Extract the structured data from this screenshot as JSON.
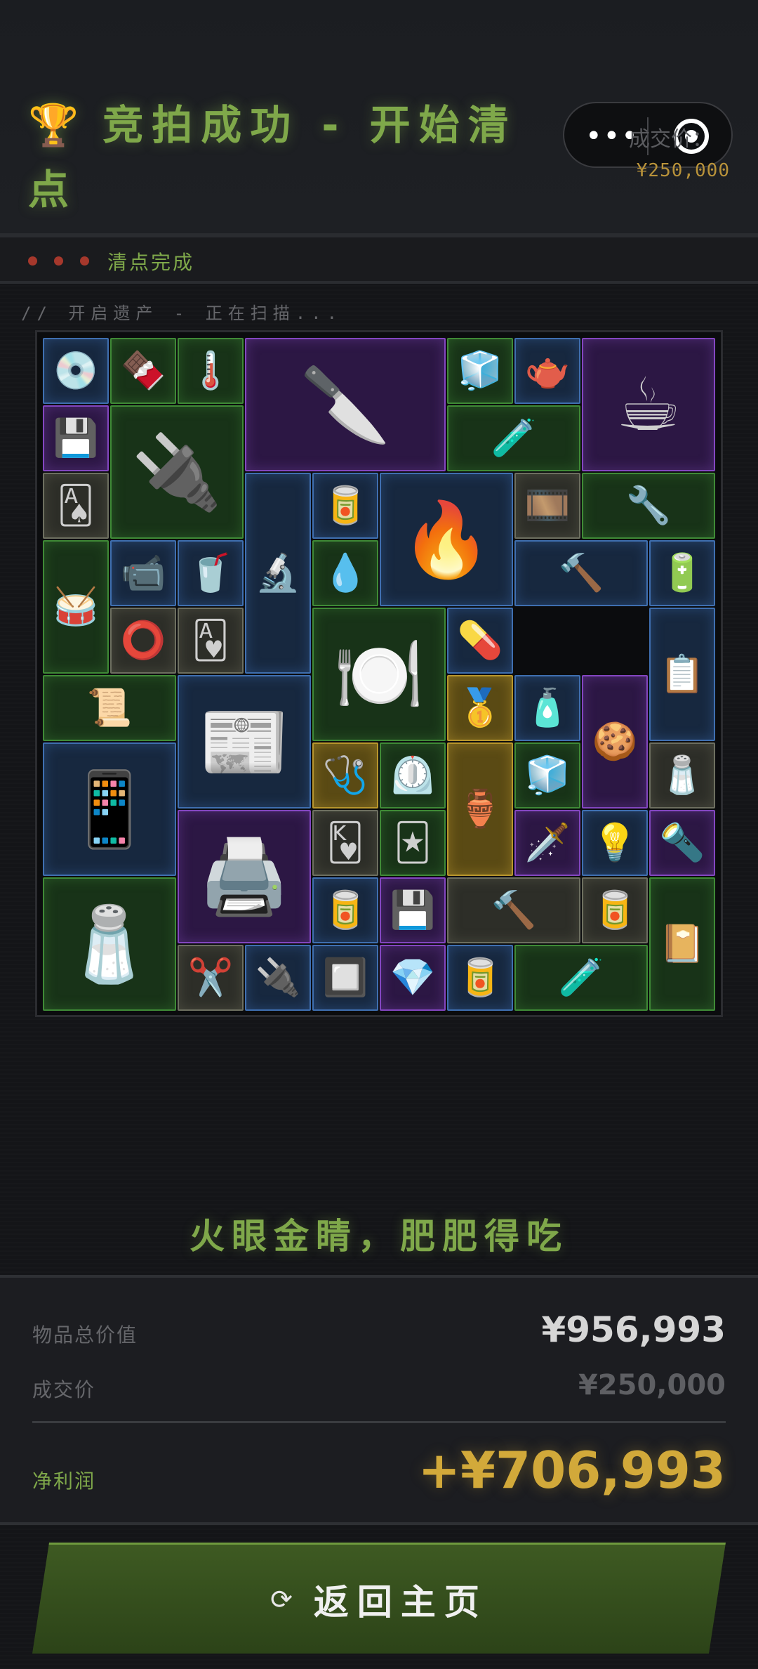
{
  "header": {
    "title": "竞拍成功 - 开始清点",
    "trophy_icon": "🏆",
    "deal_label": "成交价：",
    "deal_value": "¥250,000",
    "capsule_dots": "•••"
  },
  "status": {
    "text": "清点完成"
  },
  "scan_text": "// 开启遗产 - 正在扫描...",
  "slogan": "火眼金睛，肥肥得吃",
  "summary": {
    "total_label": "物品总价值",
    "total_value": "¥956,993",
    "deal_label": "成交价",
    "deal_value": "¥250,000",
    "profit_label": "净利润",
    "profit_value": "+¥706,993"
  },
  "button": {
    "icon": "⟳",
    "label": "返回主页"
  },
  "colors": {
    "accent_green": "#7fa84a",
    "gold": "#d2a93a",
    "rarity_blue": "#3f6fb0",
    "rarity_green": "#3f8a36",
    "rarity_purple": "#8346c0",
    "rarity_gray": "#6d6f60",
    "rarity_gold": "#b8962c"
  },
  "items": [
    {
      "name": "game-disc",
      "rarity": "blue",
      "icon": "💿"
    },
    {
      "name": "snack-bar",
      "rarity": "green",
      "icon": "🍫"
    },
    {
      "name": "thermometer-gauge",
      "rarity": "green",
      "icon": "🌡️"
    },
    {
      "name": "hunting-knife",
      "rarity": "purple",
      "icon": "🔪"
    },
    {
      "name": "cpu-cooler",
      "rarity": "green",
      "icon": "🧊"
    },
    {
      "name": "tea-tin",
      "rarity": "blue",
      "icon": "🫖"
    },
    {
      "name": "coffee-machine",
      "rarity": "purple",
      "icon": "☕"
    },
    {
      "name": "memory-stick",
      "rarity": "purple",
      "icon": "💾"
    },
    {
      "name": "power-supply",
      "rarity": "green",
      "icon": "🔌"
    },
    {
      "name": "metal-rod",
      "rarity": "green",
      "icon": "🧪"
    },
    {
      "name": "playing-card",
      "rarity": "gray",
      "icon": "🂡"
    },
    {
      "name": "microscope",
      "rarity": "blue",
      "icon": "🔬"
    },
    {
      "name": "ration-pack",
      "rarity": "blue",
      "icon": "🥫"
    },
    {
      "name": "camping-stove",
      "rarity": "blue",
      "icon": "🔥"
    },
    {
      "name": "duct-tape",
      "rarity": "gray",
      "icon": "🎞️"
    },
    {
      "name": "power-drill",
      "rarity": "green",
      "icon": "🔧"
    },
    {
      "name": "djembe-drum",
      "rarity": "green",
      "icon": "🥁"
    },
    {
      "name": "security-camera",
      "rarity": "blue",
      "icon": "📹"
    },
    {
      "name": "soda-can",
      "rarity": "blue",
      "icon": "🥤"
    },
    {
      "name": "iv-bag",
      "rarity": "green",
      "icon": "💧"
    },
    {
      "name": "rotary-hammer",
      "rarity": "blue",
      "icon": "🔨"
    },
    {
      "name": "battery-cube",
      "rarity": "blue",
      "icon": "🔋"
    },
    {
      "name": "tape-roll",
      "rarity": "gray",
      "icon": "⭕"
    },
    {
      "name": "heart-card",
      "rarity": "gray",
      "icon": "🂱"
    },
    {
      "name": "decorative-plate",
      "rarity": "green",
      "icon": "🍽️"
    },
    {
      "name": "pill-strip",
      "rarity": "blue",
      "icon": "💊"
    },
    {
      "name": "confidential-file",
      "rarity": "blue",
      "icon": "📋"
    },
    {
      "name": "old-paper",
      "rarity": "green",
      "icon": "📜"
    },
    {
      "name": "fashion-magazine",
      "rarity": "blue",
      "icon": "📰"
    },
    {
      "name": "gold-bar",
      "rarity": "gold",
      "icon": "🥇"
    },
    {
      "name": "medicine-bottle",
      "rarity": "blue",
      "icon": "🧴"
    },
    {
      "name": "gingerbread-man",
      "rarity": "purple",
      "icon": "🍪"
    },
    {
      "name": "tablet",
      "rarity": "blue",
      "icon": "📱"
    },
    {
      "name": "pulse-oximeter",
      "rarity": "gold",
      "icon": "🩺"
    },
    {
      "name": "pressure-gauge",
      "rarity": "green",
      "icon": "⏲️"
    },
    {
      "name": "glass-vase",
      "rarity": "gold",
      "icon": "🏺"
    },
    {
      "name": "cpu-cooler-2",
      "rarity": "green",
      "icon": "🧊"
    },
    {
      "name": "pepper-grinder",
      "rarity": "gray",
      "icon": "🧂"
    },
    {
      "name": "lab-shaker",
      "rarity": "purple",
      "icon": "🖨️"
    },
    {
      "name": "card-2",
      "rarity": "gray",
      "icon": "🂾"
    },
    {
      "name": "good-luck-card",
      "rarity": "green",
      "icon": "🃏"
    },
    {
      "name": "ornate-dagger",
      "rarity": "purple",
      "icon": "🗡️"
    },
    {
      "name": "light-bulb-keychain",
      "rarity": "blue",
      "icon": "💡"
    },
    {
      "name": "flashlight",
      "rarity": "purple",
      "icon": "🔦"
    },
    {
      "name": "spice-rack",
      "rarity": "green",
      "icon": "🧂"
    },
    {
      "name": "ration-pack-2",
      "rarity": "blue",
      "icon": "🥫"
    },
    {
      "name": "memory-stick-2",
      "rarity": "purple",
      "icon": "💾"
    },
    {
      "name": "claw-hammer",
      "rarity": "gray",
      "icon": "🔨"
    },
    {
      "name": "protein-tin",
      "rarity": "gray",
      "icon": "🥫"
    },
    {
      "name": "leather-journal",
      "rarity": "green",
      "icon": "📔"
    },
    {
      "name": "scissors",
      "rarity": "gray",
      "icon": "✂️"
    },
    {
      "name": "usb-drive",
      "rarity": "blue",
      "icon": "🔌"
    },
    {
      "name": "travel-adapter",
      "rarity": "blue",
      "icon": "🔲"
    },
    {
      "name": "earring",
      "rarity": "purple",
      "icon": "💎"
    },
    {
      "name": "ration-pack-3",
      "rarity": "blue",
      "icon": "🥫"
    },
    {
      "name": "metal-rod-2",
      "rarity": "green",
      "icon": "🧪"
    }
  ]
}
